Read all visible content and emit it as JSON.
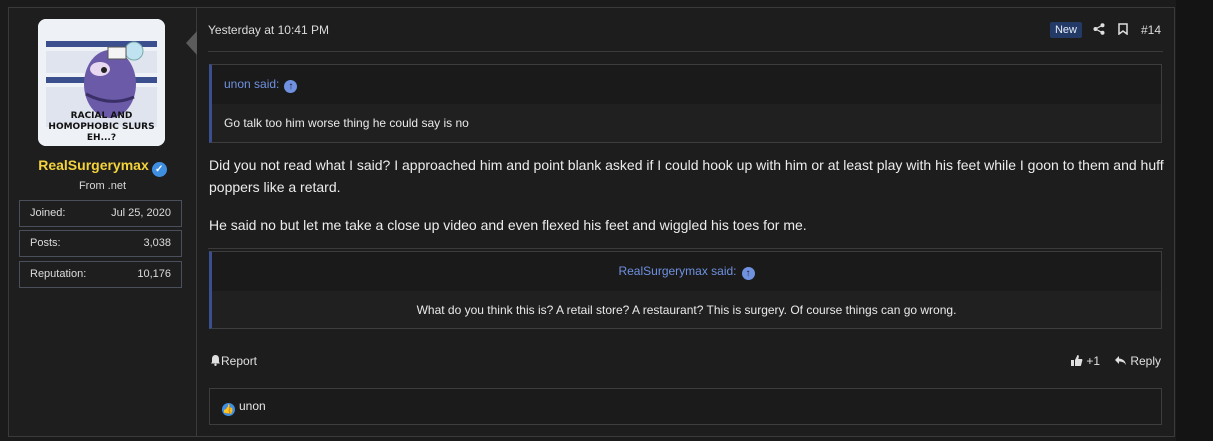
{
  "user": {
    "name": "RealSurgerymax",
    "title": "From .net",
    "stats": [
      {
        "label": "Joined:",
        "value": "Jul 25, 2020"
      },
      {
        "label": "Posts:",
        "value": "3,038"
      },
      {
        "label": "Reputation:",
        "value": "10,176"
      }
    ],
    "avatar_caption": "RACIAL AND HOMOPHOBIC SLURS EH...?"
  },
  "post": {
    "date": "Yesterday at 10:41 PM",
    "badge": "New",
    "number": "#14",
    "quote": {
      "author": "unon said:",
      "text": "Go talk too him worse thing he could say is no"
    },
    "body": [
      "Did you not read what I said? I approached him and point blank asked if I could hook up with him or at least play with his feet while I goon to them and huff poppers like a retard.",
      "He said no but let me take a close up video and even flexed his feet and wiggled his toes for me."
    ],
    "signature": {
      "author": "RealSurgerymax said:",
      "text": "What do you think this is? A retail store? A restaurant? This is surgery. Of course things can go wrong."
    },
    "actions": {
      "report": "Report",
      "like_count": "+1",
      "reply": "Reply"
    },
    "reactions": {
      "user": "unon"
    }
  },
  "icons": [
    "verified-icon",
    "share-icon",
    "bookmark-icon",
    "up-arrow-icon",
    "bell-icon",
    "thumbs-up-icon",
    "reply-icon",
    "like-icon"
  ],
  "colors": {
    "username": "#f3d23b",
    "link": "#6f91e0",
    "badge": "#233a66"
  }
}
